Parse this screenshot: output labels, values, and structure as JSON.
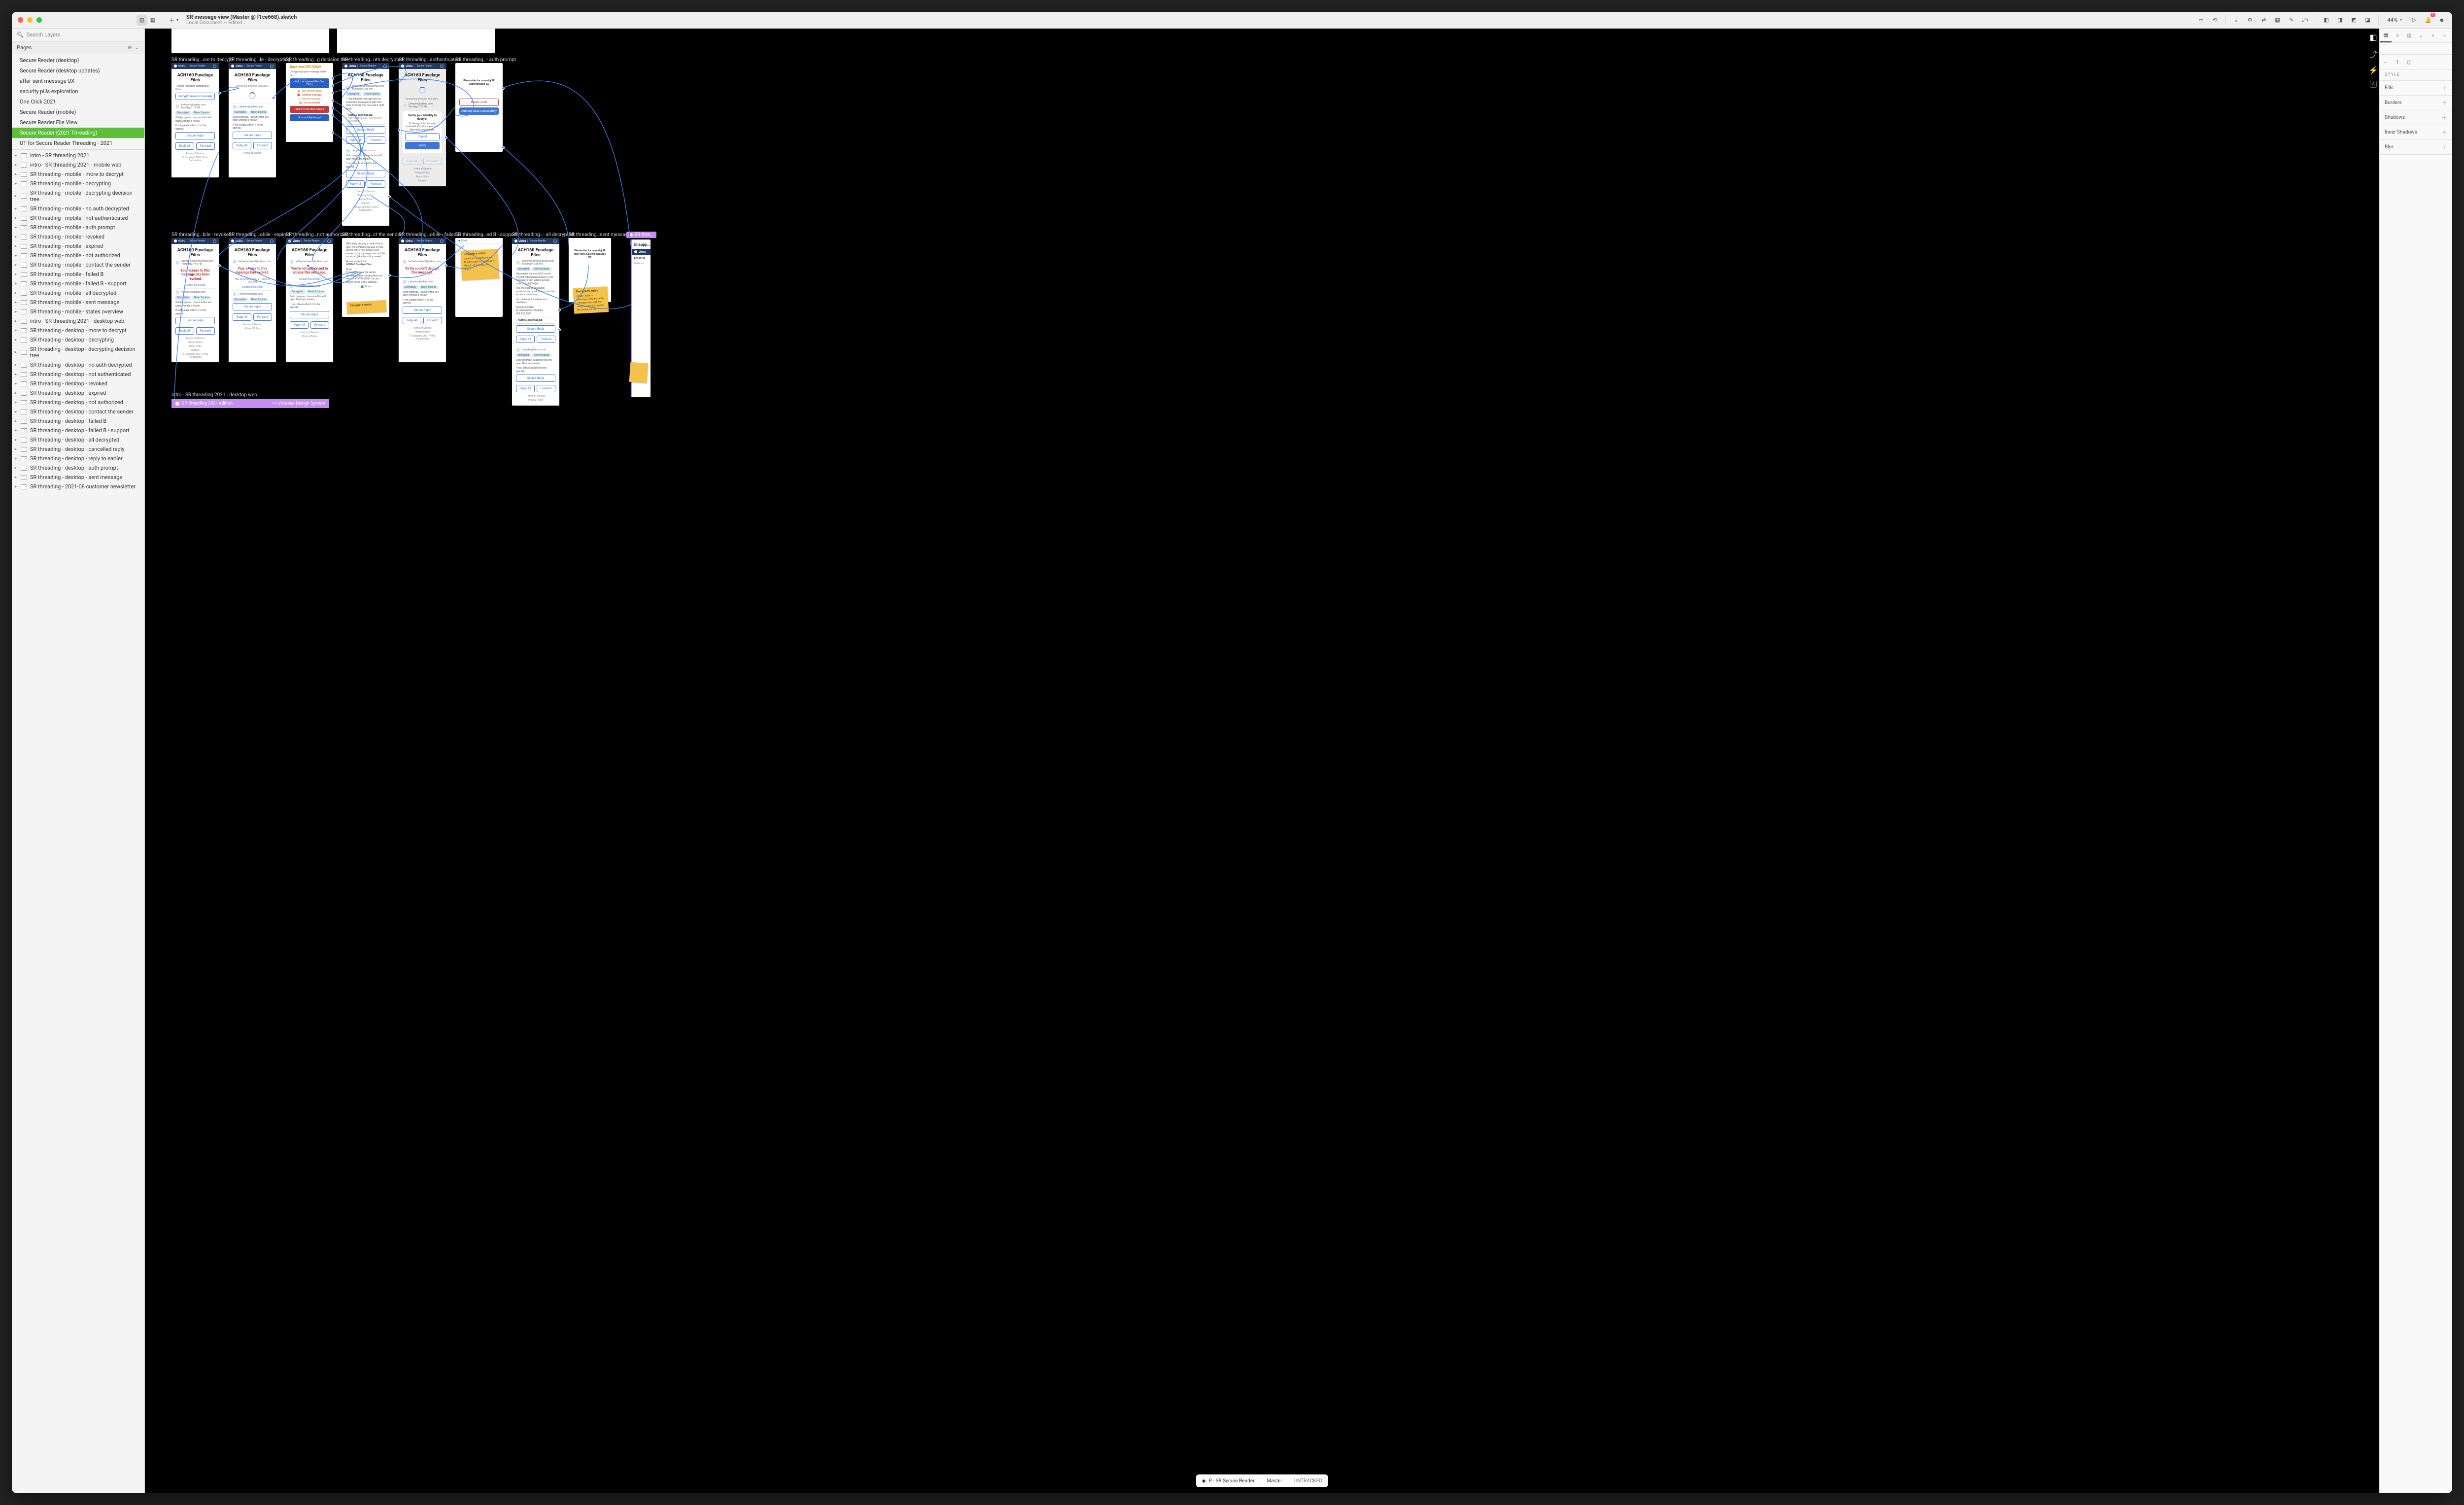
{
  "titlebar": {
    "title": "SR message view (Master @ f1ce668).sketch",
    "subtitle": "Local Document — Edited",
    "zoom": "44%",
    "notification_count": "1"
  },
  "sidebar": {
    "search_placeholder": "Search Layers",
    "pages_header": "Pages",
    "pages": [
      "Secure Reader (desktop)",
      "Secure Reader (desktop updates)",
      "after sent message UX",
      "security pills exploration",
      "One Click 2021",
      "Secure Reader (mobile)",
      "Secure Reader File View",
      "Secure Reader (2021 Threading)",
      "UT for Secure Reader Threading - 2021"
    ],
    "selected_page_index": 7,
    "layers": [
      "intro - SR threading 2021",
      "intro - SR threading 2021 - mobile web",
      "SR threading - mobile - more to decrypt",
      "SR threading - mobile - decrypting",
      "SR threading - mobile - decrypting decision tree",
      "SR threading - mobile - no auth decrypted",
      "SR threading - mobile - not authenticated",
      "SR threading - mobile - auth prompt",
      "SR threading - mobile - revoked",
      "SR threading - mobile - expired",
      "SR threading - mobile - not authorized",
      "SR threading - mobile - contact the sender",
      "SR threading - mobile - failed B",
      "SR threading - mobile - failed B - support",
      "SR threading - mobile - all decrypted",
      "SR threading - mobile - sent message",
      "SR threading - mobile - states overview",
      "intro - SR threading 2021 - desktop web",
      "SR threading - desktop - more to decrypt",
      "SR threading - desktop - decrypting",
      "SR threading - desktop - decrypting decision tree",
      "SR threading - desktop - no auth decrypted",
      "SR threading - desktop - not authenticated",
      "SR threading - desktop - revoked",
      "SR threading - desktop - expired",
      "SR threading - desktop - not authorized",
      "SR threading - desktop - contact the sender",
      "SR threading - desktop - failed B",
      "SR threading - desktop - failed B - support",
      "SR threading - desktop - all decrypted",
      "SR threading - desktop - cancelled reply",
      "SR threading - desktop - reply to earlier",
      "SR threading - desktop - auth prompt",
      "SR threading - desktop - sent message",
      "SR threading - 2021-08 customer newsletter"
    ]
  },
  "canvas": {
    "row1_labels": [
      "SR threading…ore to decrypt",
      "SR threading…le - decrypting",
      "SR threading…g decision tree",
      "SR threading…uth decrypted",
      "SR threading…authenticated",
      "SR threading…- auth prompt"
    ],
    "row2_labels": [
      "SR threading…bile - revoked",
      "SR threading…obile - expired",
      "SR threading…not authorized",
      "SR threading…ct the sender",
      "SR threading…obile - failed B",
      "SR threading…ed B - support",
      "SR threading…- all decrypted",
      "SR threading…sent message",
      "SR threadin…"
    ],
    "common": {
      "brand": "virtru",
      "sr": "Secure Reader",
      "title": "ACH160 Fuselage Files",
      "from1": "katherine.dewitt@airbus.com",
      "from2": "j.whyden@airbus.com",
      "date1": "Yesterday, 9:40 PM",
      "date2": "Monday, 3:10 PM",
      "pill_decrypted": "Decrypted",
      "pill_never": "Never Expires",
      "pill_encrypted": "Encrypted",
      "reply": "Secure Reply",
      "reply_all": "Reply All",
      "forward": "Forward",
      "tos": "Terms of Service",
      "privacy": "Privacy Policy",
      "about": "About Virtru",
      "support": "Support",
      "copyright": "© Copyright 2021 Virtru Corporation",
      "para1": "Solid progress. I assume this will open Monday's review.",
      "para2": "If not, please attach it to the agenda."
    },
    "ab1": {
      "earlier": "1 earlier message protected by Virtru",
      "btn": "Decrypt previous message"
    },
    "ab2": {
      "status": "Decrypting previous message…"
    },
    "ab3": {
      "title": "Back-end DECISION",
      "sub": "Decrypting a prev message leads to…",
      "o1": "Auth not required (like One Click)",
      "o2": "Not authenticated",
      "o3": "Revoked message",
      "o4": "Expired message",
      "o5": "Not authorized",
      "o6": "Failure for all other reasons",
      "done": "Successfully decrypt"
    },
    "ab4": {
      "note": "• This previous message had no authentication required (like One Click Access). You can read it right away!",
      "att": "ACH160-drawings.jpg",
      "att_sub": "Not Watermarked • Community Protected"
    },
    "ab5": {
      "status": "Decrypting previous message…",
      "verify": "Verify your identity to decrypt",
      "verify_sub": "To decrypt this message protected with Virtru, you must first verify your identity.",
      "cancel": "Cancel",
      "go": "Verify"
    },
    "ab6": {
      "placeholder": "Placeholder for current ▮ SR authentication UX",
      "fail": "Doesn't auth",
      "ok": "Authenticates successfully"
    },
    "revoked": {
      "msg": "Your access to this message has been revoked.",
      "link": "Contact the sender"
    },
    "expired": {
      "msg": "Your access to this message has expired.",
      "sub": "This occurred on Apr 21, 2019 at 7:57 PM",
      "link": "Contact the sender"
    },
    "unauth": {
      "msg": "You're not authorized to access this message.",
      "link": "Contact the sender"
    },
    "contact": {
      "p1": "Effectively clicking a mailto link to open the default email app on this device with a new email to the sender of the message that can't be accessed (aka the policy owner).",
      "p2": "Re-use subject line:",
      "p2b": "ACH160 Fuselage Files",
      "p3": "Body:",
      "p3b": "Hi, I can't access the earlier message in this conversation you sent on YYYY-MM-DD. Can you please check Virtru settings?",
      "done": "Done"
    },
    "failed": {
      "msg": "Virtru couldn't decrypt this message."
    },
    "support": {
      "back": "Back",
      "note_title": "Designer's notes",
      "note": "Re-use the existing Secure Reader support screen as-is. (Match all existing URL args.)"
    },
    "alldec": {
      "p1": "Attached is the new CAD for the H125M cabin design based on the fuselage in next week's access code is 5g_HjQh3(A)",
      "p2": "The link itself is password protected and you'll have to use the access code above.",
      "p3": "Let me know if you have any questions.",
      "sig1": "Katharine DeWitt",
      "sig2": "Sr. Aeronautical Engineer",
      "sig3": "908.230.5700",
      "att": "ACH160-drawings.jpg"
    },
    "sent": {
      "placeholder": "Placeholder for current ▮ SR reply form & ▮ sent message UX",
      "note_title": "Designer's notes",
      "note": "Ideally “Back to messages” returns to the message view with the msg that was just sent in the thread, on top."
    },
    "unsup": {
      "title": "Unsupp…",
      "sr_threading": "SR thre…",
      "excited": "Excited to…"
    },
    "intro_label": "intro - SR threading 2021 - desktop web",
    "banner": {
      "left": "SR threading 2021 edition",
      "right": ">> Virtuoso Design System"
    }
  },
  "bottombar": {
    "project": "P - SR Secure Reader",
    "branch": "Master",
    "status": "UNTRACKED"
  },
  "inspector": {
    "style": "STYLE",
    "sections": [
      "Fills",
      "Borders",
      "Shadows",
      "Inner Shadows",
      "Blur"
    ]
  }
}
